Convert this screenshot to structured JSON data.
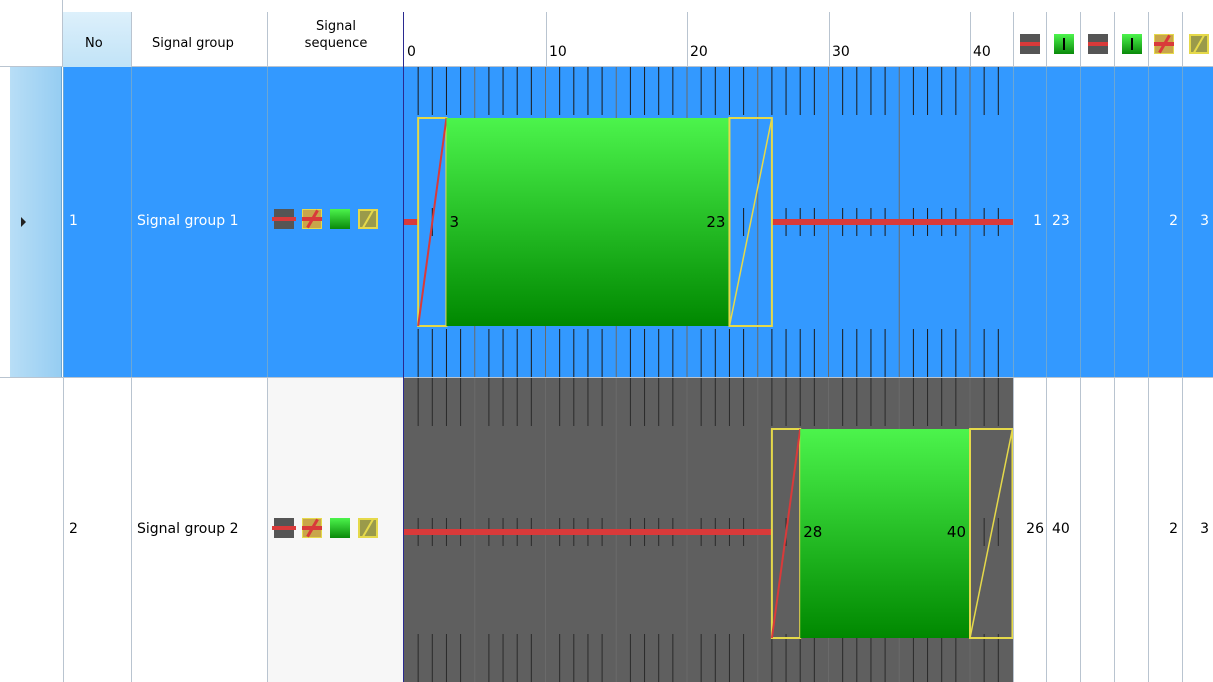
{
  "header": {
    "no": "No",
    "signal_group": "Signal group",
    "signal_sequence": "Signal\nsequence",
    "ticks": [
      "0",
      "10",
      "20",
      "30",
      "40"
    ],
    "state_icons": [
      "red-icon",
      "green-icon",
      "red-icon",
      "green-icon",
      "red-amber-icon",
      "amber-icon"
    ]
  },
  "rows": [
    {
      "no": "1",
      "name": "Signal group 1",
      "selected": true,
      "green_start_label": "3",
      "green_end_label": "23",
      "green_start": 3,
      "green_end": 23,
      "values": [
        "1",
        "23",
        "",
        "",
        "2",
        "3"
      ]
    },
    {
      "no": "2",
      "name": "Signal group 2",
      "selected": false,
      "green_start_label": "28",
      "green_end_label": "40",
      "green_start": 28,
      "green_end": 40,
      "values": [
        "26",
        "40",
        "",
        "",
        "2",
        "3"
      ]
    }
  ],
  "colors": {
    "selection": "#3399ff",
    "timeline_bg": "#5f5f5f",
    "red": "#d93a3a",
    "green_top": "#4cf44c",
    "green_bottom": "#008800",
    "amber": "#e5d94a"
  }
}
